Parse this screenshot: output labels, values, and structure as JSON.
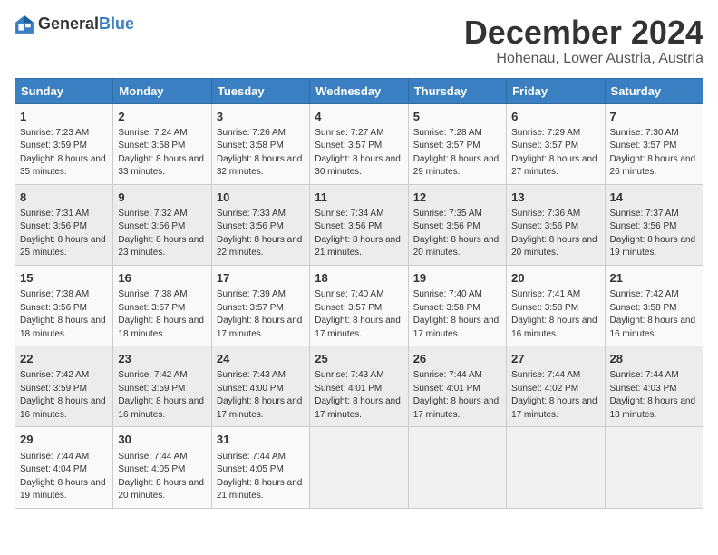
{
  "header": {
    "logo_general": "General",
    "logo_blue": "Blue",
    "month": "December 2024",
    "location": "Hohenau, Lower Austria, Austria"
  },
  "weekdays": [
    "Sunday",
    "Monday",
    "Tuesday",
    "Wednesday",
    "Thursday",
    "Friday",
    "Saturday"
  ],
  "weeks": [
    [
      {
        "day": "1",
        "info": "Sunrise: 7:23 AM\nSunset: 3:59 PM\nDaylight: 8 hours and 35 minutes."
      },
      {
        "day": "2",
        "info": "Sunrise: 7:24 AM\nSunset: 3:58 PM\nDaylight: 8 hours and 33 minutes."
      },
      {
        "day": "3",
        "info": "Sunrise: 7:26 AM\nSunset: 3:58 PM\nDaylight: 8 hours and 32 minutes."
      },
      {
        "day": "4",
        "info": "Sunrise: 7:27 AM\nSunset: 3:57 PM\nDaylight: 8 hours and 30 minutes."
      },
      {
        "day": "5",
        "info": "Sunrise: 7:28 AM\nSunset: 3:57 PM\nDaylight: 8 hours and 29 minutes."
      },
      {
        "day": "6",
        "info": "Sunrise: 7:29 AM\nSunset: 3:57 PM\nDaylight: 8 hours and 27 minutes."
      },
      {
        "day": "7",
        "info": "Sunrise: 7:30 AM\nSunset: 3:57 PM\nDaylight: 8 hours and 26 minutes."
      }
    ],
    [
      {
        "day": "8",
        "info": "Sunrise: 7:31 AM\nSunset: 3:56 PM\nDaylight: 8 hours and 25 minutes."
      },
      {
        "day": "9",
        "info": "Sunrise: 7:32 AM\nSunset: 3:56 PM\nDaylight: 8 hours and 23 minutes."
      },
      {
        "day": "10",
        "info": "Sunrise: 7:33 AM\nSunset: 3:56 PM\nDaylight: 8 hours and 22 minutes."
      },
      {
        "day": "11",
        "info": "Sunrise: 7:34 AM\nSunset: 3:56 PM\nDaylight: 8 hours and 21 minutes."
      },
      {
        "day": "12",
        "info": "Sunrise: 7:35 AM\nSunset: 3:56 PM\nDaylight: 8 hours and 20 minutes."
      },
      {
        "day": "13",
        "info": "Sunrise: 7:36 AM\nSunset: 3:56 PM\nDaylight: 8 hours and 20 minutes."
      },
      {
        "day": "14",
        "info": "Sunrise: 7:37 AM\nSunset: 3:56 PM\nDaylight: 8 hours and 19 minutes."
      }
    ],
    [
      {
        "day": "15",
        "info": "Sunrise: 7:38 AM\nSunset: 3:56 PM\nDaylight: 8 hours and 18 minutes."
      },
      {
        "day": "16",
        "info": "Sunrise: 7:38 AM\nSunset: 3:57 PM\nDaylight: 8 hours and 18 minutes."
      },
      {
        "day": "17",
        "info": "Sunrise: 7:39 AM\nSunset: 3:57 PM\nDaylight: 8 hours and 17 minutes."
      },
      {
        "day": "18",
        "info": "Sunrise: 7:40 AM\nSunset: 3:57 PM\nDaylight: 8 hours and 17 minutes."
      },
      {
        "day": "19",
        "info": "Sunrise: 7:40 AM\nSunset: 3:58 PM\nDaylight: 8 hours and 17 minutes."
      },
      {
        "day": "20",
        "info": "Sunrise: 7:41 AM\nSunset: 3:58 PM\nDaylight: 8 hours and 16 minutes."
      },
      {
        "day": "21",
        "info": "Sunrise: 7:42 AM\nSunset: 3:58 PM\nDaylight: 8 hours and 16 minutes."
      }
    ],
    [
      {
        "day": "22",
        "info": "Sunrise: 7:42 AM\nSunset: 3:59 PM\nDaylight: 8 hours and 16 minutes."
      },
      {
        "day": "23",
        "info": "Sunrise: 7:42 AM\nSunset: 3:59 PM\nDaylight: 8 hours and 16 minutes."
      },
      {
        "day": "24",
        "info": "Sunrise: 7:43 AM\nSunset: 4:00 PM\nDaylight: 8 hours and 17 minutes."
      },
      {
        "day": "25",
        "info": "Sunrise: 7:43 AM\nSunset: 4:01 PM\nDaylight: 8 hours and 17 minutes."
      },
      {
        "day": "26",
        "info": "Sunrise: 7:44 AM\nSunset: 4:01 PM\nDaylight: 8 hours and 17 minutes."
      },
      {
        "day": "27",
        "info": "Sunrise: 7:44 AM\nSunset: 4:02 PM\nDaylight: 8 hours and 17 minutes."
      },
      {
        "day": "28",
        "info": "Sunrise: 7:44 AM\nSunset: 4:03 PM\nDaylight: 8 hours and 18 minutes."
      }
    ],
    [
      {
        "day": "29",
        "info": "Sunrise: 7:44 AM\nSunset: 4:04 PM\nDaylight: 8 hours and 19 minutes."
      },
      {
        "day": "30",
        "info": "Sunrise: 7:44 AM\nSunset: 4:05 PM\nDaylight: 8 hours and 20 minutes."
      },
      {
        "day": "31",
        "info": "Sunrise: 7:44 AM\nSunset: 4:05 PM\nDaylight: 8 hours and 21 minutes."
      },
      null,
      null,
      null,
      null
    ]
  ]
}
